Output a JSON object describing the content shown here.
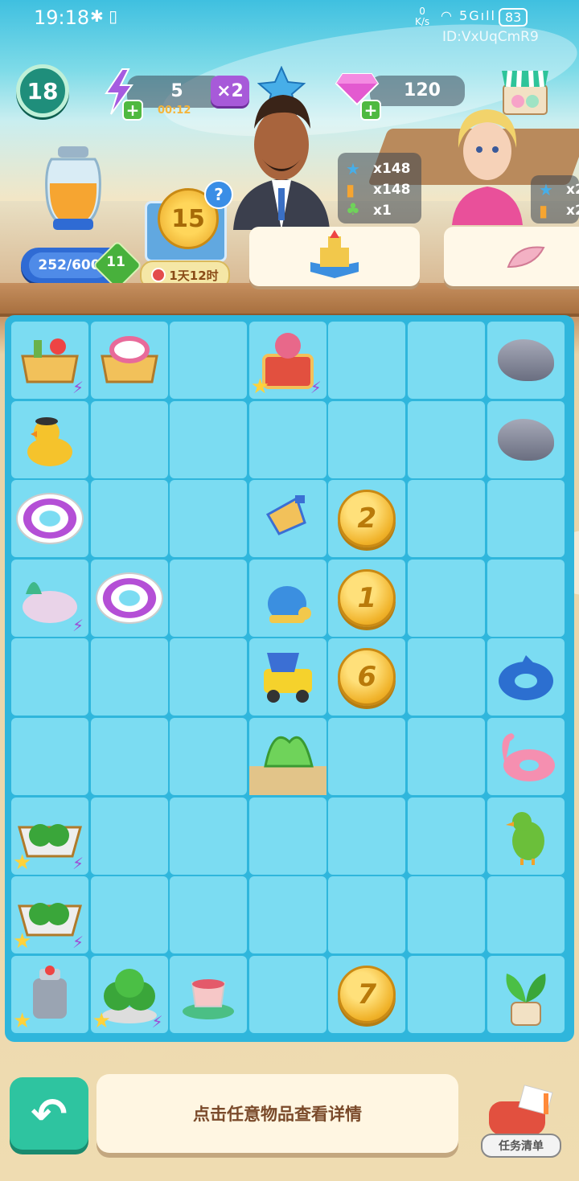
{
  "status_bar": {
    "time": "19:18",
    "net_speed_top": "0",
    "net_speed_bottom": "K/s",
    "network": "5G",
    "battery": "83"
  },
  "player_id": "ID:VxUqCmR9",
  "top_bar": {
    "level": "18",
    "energy": "5",
    "energy_timer": "00:12",
    "energy_boost": "×2",
    "stars": "252",
    "gems": "120"
  },
  "jar": {
    "capacity": "252/600",
    "badge": "11"
  },
  "event": {
    "coin_value": "15",
    "help": "?",
    "timer": "1天12时"
  },
  "orders": [
    {
      "rows": [
        {
          "icon": "star-icon",
          "text": "x148"
        },
        {
          "icon": "juice-icon",
          "text": "x148"
        },
        {
          "icon": "energy-icon",
          "text": "x1"
        }
      ]
    },
    {
      "rows": [
        {
          "icon": "star-icon",
          "text": "x2"
        },
        {
          "icon": "juice-icon",
          "text": "x2"
        }
      ]
    }
  ],
  "board": {
    "coins": [
      {
        "row": 2,
        "col": 4,
        "value": "2"
      },
      {
        "row": 3,
        "col": 4,
        "value": "1"
      },
      {
        "row": 4,
        "col": 4,
        "value": "6"
      },
      {
        "row": 8,
        "col": 4,
        "value": "7"
      }
    ]
  },
  "bottom": {
    "back_icon": "back-arrow-icon",
    "hint": "点击任意物品查看详情",
    "task_label": "任务清单"
  },
  "colors": {
    "board": "#2fb6dc",
    "cell": "#7bdcf2",
    "accent_green": "#2ec4a0",
    "energy_purple": "#a75ad9"
  }
}
